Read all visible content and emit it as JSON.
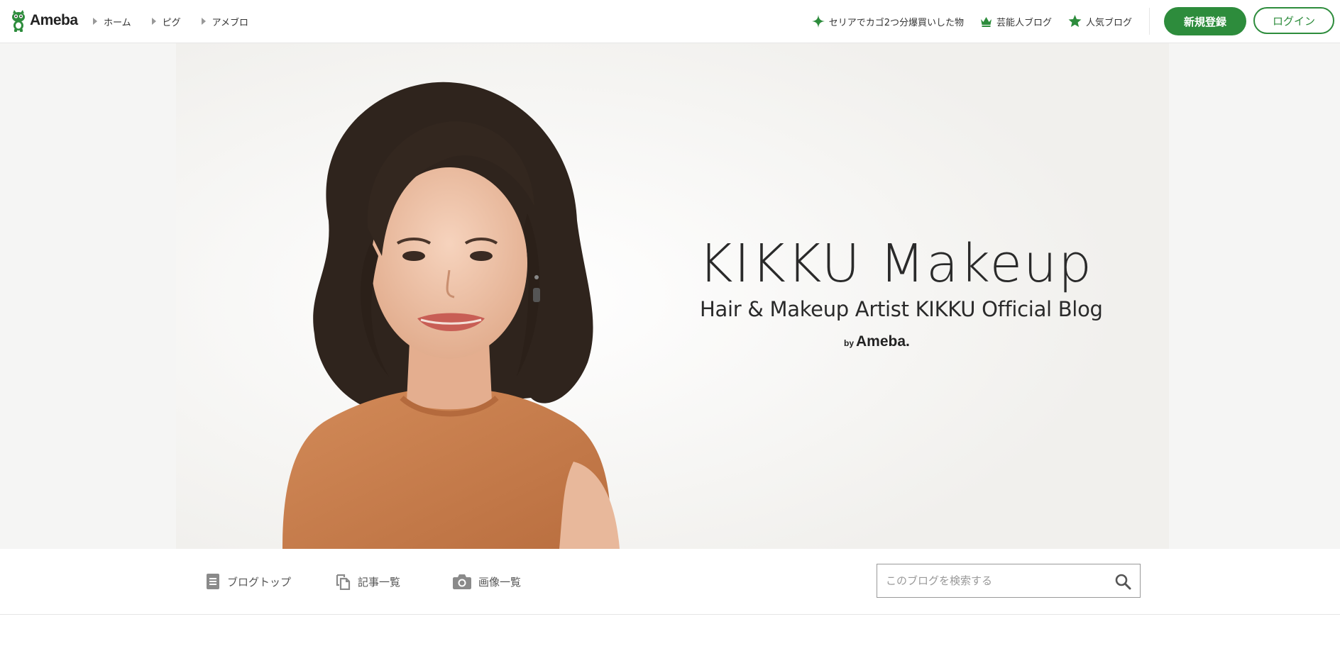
{
  "header": {
    "logo_text": "Ameba",
    "breadcrumbs": [
      "ホーム",
      "ピグ",
      "アメブロ"
    ],
    "links": [
      {
        "icon": "sparkle-icon",
        "label": "セリアでカゴ2つ分爆買いした物"
      },
      {
        "icon": "crown-icon",
        "label": "芸能人ブログ"
      },
      {
        "icon": "star-icon",
        "label": "人気ブログ"
      }
    ],
    "signup_label": "新規登録",
    "login_label": "ログイン"
  },
  "hero": {
    "title": "KIKKU Makeup",
    "subtitle": "Hair & Makeup Artist KIKKU Official Blog",
    "by": "by",
    "by_brand": "Ameba."
  },
  "blog_nav": {
    "items": [
      {
        "icon": "document-icon",
        "label": "ブログトップ"
      },
      {
        "icon": "copy-list-icon",
        "label": "記事一覧"
      },
      {
        "icon": "camera-icon",
        "label": "画像一覧"
      }
    ],
    "search_placeholder": "このブログを検索する"
  },
  "colors": {
    "brand_green": "#2d8c3c",
    "link_icon_green": "#2d8c3c"
  }
}
